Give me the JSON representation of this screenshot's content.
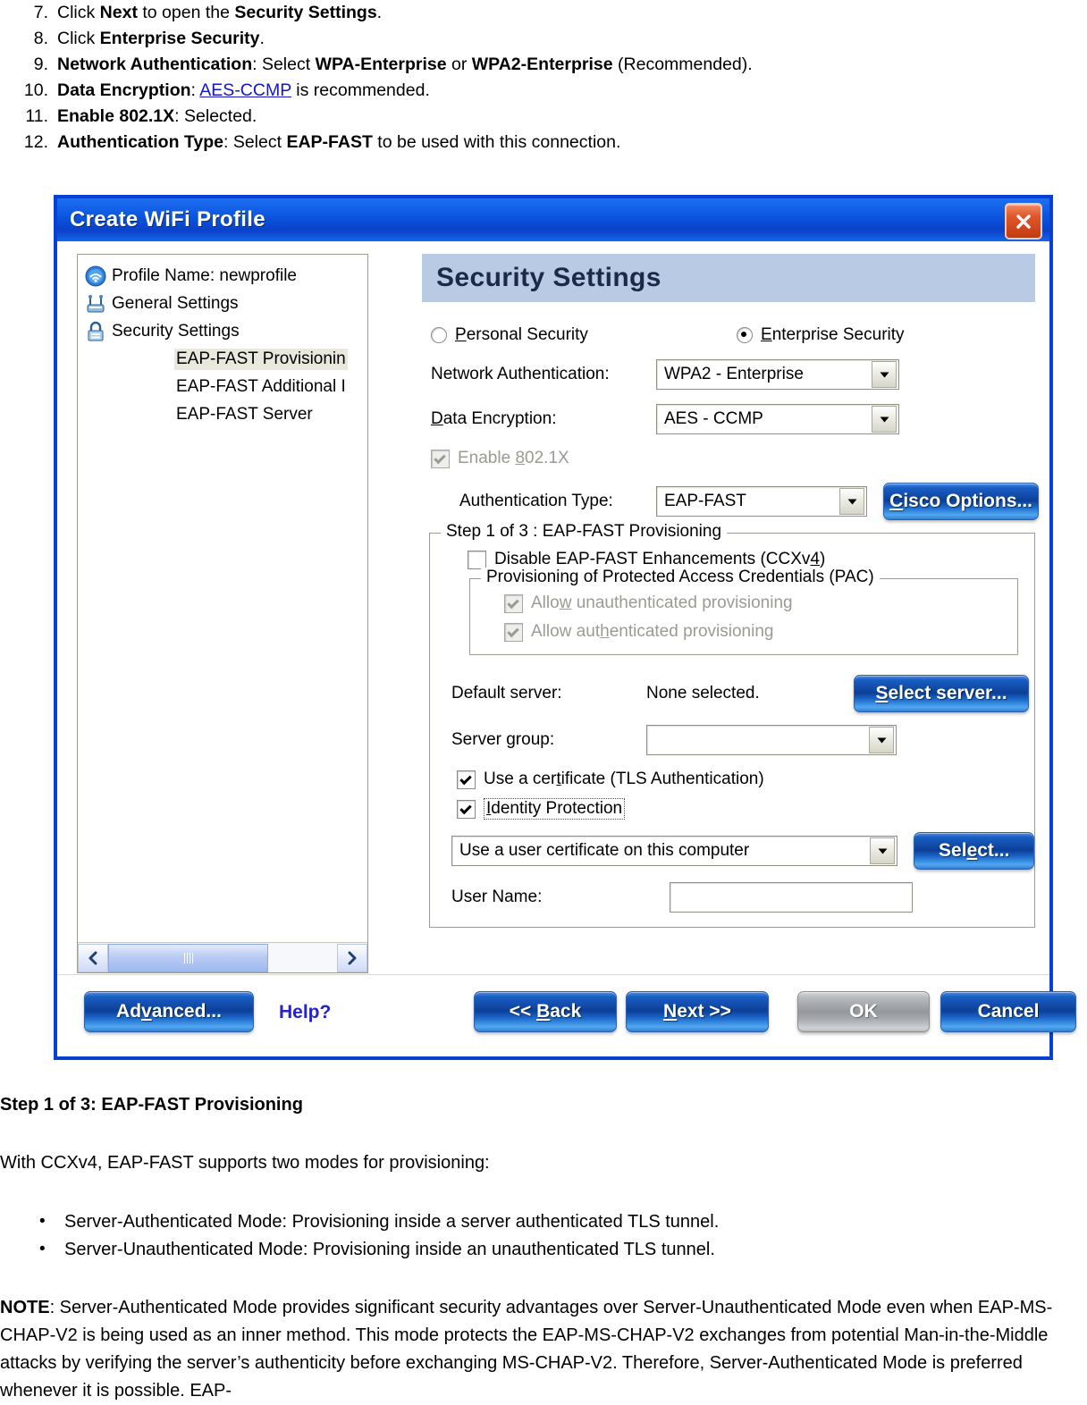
{
  "steps": [
    {
      "num": "7.",
      "parts": [
        {
          "t": "Click ",
          "b": false
        },
        {
          "t": "Next",
          "b": true
        },
        {
          "t": " to open the ",
          "b": false
        },
        {
          "t": "Security Settings",
          "b": true
        },
        {
          "t": ".",
          "b": false
        }
      ]
    },
    {
      "num": "8.",
      "parts": [
        {
          "t": "Click ",
          "b": false
        },
        {
          "t": "Enterprise Security",
          "b": true
        },
        {
          "t": ".",
          "b": false
        }
      ]
    },
    {
      "num": "9.",
      "parts": [
        {
          "t": "Network Authentication",
          "b": true
        },
        {
          "t": ": Select ",
          "b": false
        },
        {
          "t": "WPA-Enterprise",
          "b": true
        },
        {
          "t": " or ",
          "b": false
        },
        {
          "t": "WPA2-Enterprise",
          "b": true
        },
        {
          "t": " (Recommended).",
          "b": false
        }
      ]
    },
    {
      "num": "10.",
      "parts": [
        {
          "t": "Data Encryption",
          "b": true
        },
        {
          "t": ": ",
          "b": false
        },
        {
          "t": "AES-CCMP",
          "b": false,
          "link": true
        },
        {
          "t": " is recommended.",
          "b": false
        }
      ]
    },
    {
      "num": "11.",
      "parts": [
        {
          "t": "Enable 802.1X",
          "b": true
        },
        {
          "t": ": Selected.",
          "b": false
        }
      ]
    },
    {
      "num": "12.",
      "parts": [
        {
          "t": "Authentication Type",
          "b": true
        },
        {
          "t": ": Select ",
          "b": false
        },
        {
          "t": "EAP-FAST",
          "b": true
        },
        {
          "t": " to be used with this connection.",
          "b": false
        }
      ]
    }
  ],
  "dialog": {
    "title": "Create WiFi Profile",
    "close_icon": "close-icon",
    "tree": {
      "items": [
        {
          "label": "Profile Name: newprofile",
          "icon": "wifi-icon",
          "child": false,
          "selected": false
        },
        {
          "label": "General Settings",
          "icon": "general-settings-icon",
          "child": false,
          "selected": false
        },
        {
          "label": "Security Settings",
          "icon": "lock-icon",
          "child": false,
          "selected": false
        },
        {
          "label": "EAP-FAST Provisionin",
          "icon": "",
          "child": true,
          "selected": true
        },
        {
          "label": "EAP-FAST Additional I",
          "icon": "",
          "child": true,
          "selected": false
        },
        {
          "label": "EAP-FAST Server",
          "icon": "",
          "child": true,
          "selected": false
        }
      ],
      "scroll_left_icon": "chevron-left-icon",
      "scroll_right_icon": "chevron-right-icon"
    },
    "pane": {
      "heading": "Security Settings",
      "security_mode": {
        "personal": {
          "label_pre": "P",
          "label_post": "ersonal Security",
          "selected": false
        },
        "enterprise": {
          "label_pre": "E",
          "label_post": "nterprise Security",
          "selected": true
        }
      },
      "network_authentication": {
        "label": "Network Authentication:",
        "value": "WPA2 - Enterprise"
      },
      "data_encryption": {
        "label_pre": "D",
        "label_post": "ata Encryption:",
        "value": "AES - CCMP"
      },
      "enable_8021x": {
        "label_pre": "Enable ",
        "label_accel": "8",
        "label_post": "02.1X",
        "checked": true,
        "disabled": true
      },
      "authentication_type": {
        "label": "Authentication Type:",
        "value": "EAP-FAST"
      },
      "cisco_options_button": {
        "label_pre": "C",
        "label_post": "isco Options..."
      },
      "step_group": {
        "legend": "Step 1 of 3 : EAP-FAST Provisioning",
        "disable_enhancements": {
          "label_pre": "Disable EAP-FAST Enhancements (CCXv",
          "label_accel": "4",
          "label_post": ")",
          "checked": false
        },
        "pac_group": {
          "legend": "Provisioning of Protected Access Credentials (PAC)",
          "allow_unauth": {
            "label_pre": "Allo",
            "label_accel": "w",
            "label_post": " unauthenticated provisioning",
            "checked": true,
            "disabled": true
          },
          "allow_auth": {
            "label_pre": "Allow aut",
            "label_accel": "h",
            "label_post": "enticated provisioning",
            "checked": true,
            "disabled": true
          }
        },
        "default_server": {
          "label": "Default server:",
          "value": "None selected."
        },
        "select_server_button": {
          "label_pre": "S",
          "label_post": "elect server..."
        },
        "server_group": {
          "label": "Server group:",
          "value": ""
        },
        "use_certificate": {
          "label_pre": "Use a cer",
          "label_accel": "t",
          "label_post": "ificate (TLS Authentication)",
          "checked": true
        },
        "identity_protection": {
          "label_pre": "I",
          "label_post": "dentity Protection",
          "checked": true
        },
        "certificate_source": {
          "value": "Use a user certificate on this computer"
        },
        "select_button": {
          "label_pre": "Sel",
          "label_accel": "e",
          "label_post": "ct..."
        },
        "user_name": {
          "label": "User Name:",
          "value": ""
        }
      }
    },
    "footer": {
      "advanced": {
        "label_pre": "Ad",
        "label_accel": "v",
        "label_post": "anced..."
      },
      "help": "Help?",
      "back": {
        "label_pre": "<< ",
        "label_accel": "B",
        "label_post": "ack"
      },
      "next": {
        "label_pre": "",
        "label_accel": "N",
        "label_post": "ext >>"
      },
      "ok": {
        "label": "OK",
        "disabled": true
      },
      "cancel": {
        "label": "Cancel"
      }
    }
  },
  "below": {
    "step_heading": "Step 1 of 3: EAP-FAST Provisioning",
    "intro": "With CCXv4, EAP-FAST supports two modes for provisioning:",
    "bullets": [
      "Server-Authenticated Mode: Provisioning inside a server authenticated TLS tunnel.",
      "Server-Unauthenticated Mode: Provisioning inside an unauthenticated TLS tunnel."
    ],
    "note_label": "NOTE",
    "note_body": ": Server-Authenticated Mode provides significant security advantages over Server-Unauthenticated Mode even when EAP-MS-CHAP-V2 is being used as an inner method. This mode protects the EAP-MS-CHAP-V2 exchanges from potential Man-in-the-Middle attacks by verifying the server’s authenticity before exchanging MS-CHAP-V2. Therefore, Server-Authenticated Mode is preferred whenever it is possible. EAP-"
  }
}
